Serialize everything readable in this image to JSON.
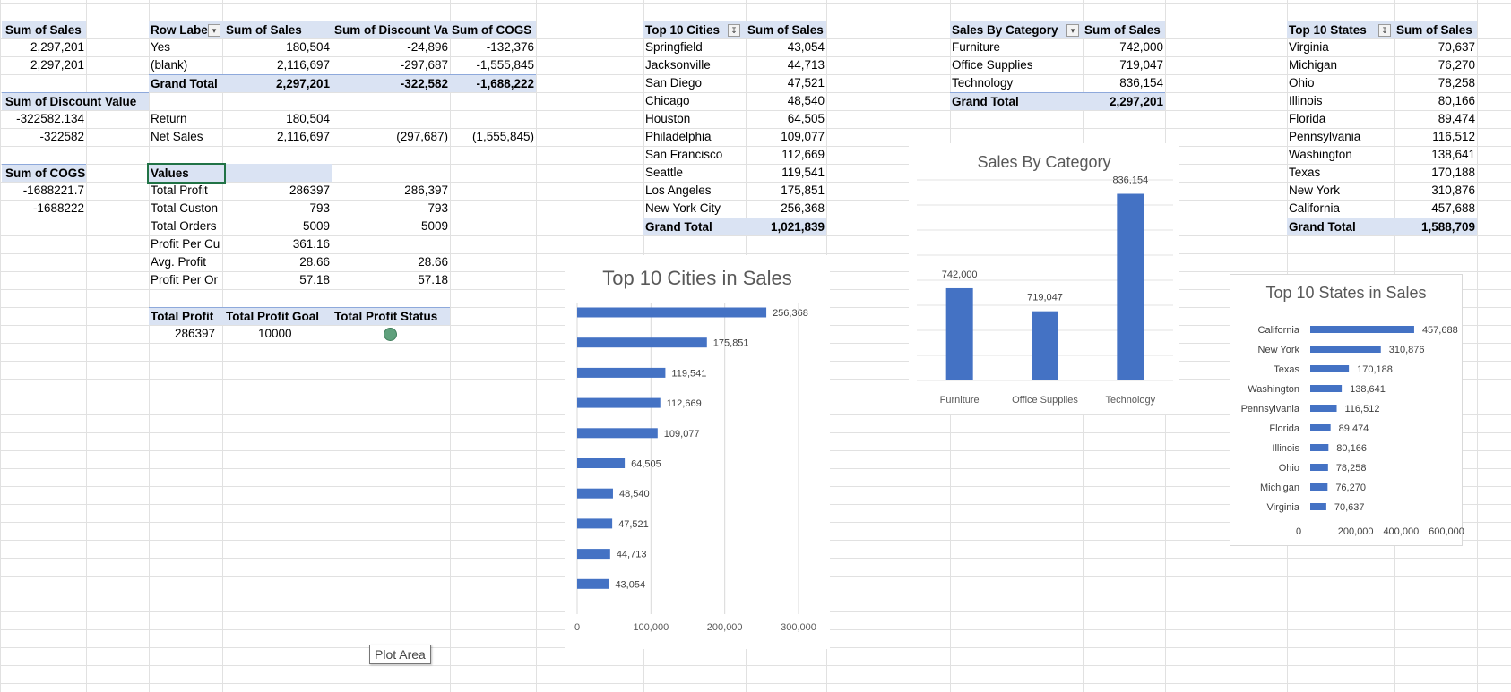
{
  "pivot_sales_total": {
    "header": "Sum of Sales",
    "values": [
      "2,297,201",
      "2,297,201"
    ]
  },
  "pivot_discount_total": {
    "header": "Sum of Discount Value",
    "values": [
      "-322582.134",
      "-322582"
    ]
  },
  "pivot_cogs_total": {
    "header": "Sum of COGS",
    "values": [
      "-1688221.7",
      "-1688222"
    ]
  },
  "pivot_main": {
    "headers": [
      "Row Labe",
      "Sum of Sales",
      "Sum of Discount Va",
      "Sum of COGS"
    ],
    "rows": [
      [
        "Yes",
        "180,504",
        "-24,896",
        "-132,376"
      ],
      [
        "(blank)",
        "2,116,697",
        "-297,687",
        "-1,555,845"
      ],
      [
        "Grand Total",
        "2,297,201",
        "-322,582",
        "-1,688,222"
      ]
    ]
  },
  "net_table": {
    "rows": [
      [
        "Return",
        "180,504",
        "",
        ""
      ],
      [
        "Net Sales",
        "2,116,697",
        "(297,687)",
        "(1,555,845)"
      ]
    ]
  },
  "values_table": {
    "header": "Values",
    "rows": [
      [
        "Total Profit",
        "286397",
        "286,397"
      ],
      [
        "Total Custon",
        "793",
        "793"
      ],
      [
        "Total Orders",
        "5009",
        "5009"
      ],
      [
        "Profit Per Cu",
        "361.16",
        ""
      ],
      [
        "Avg. Profit",
        "28.66",
        "28.66"
      ],
      [
        "Profit Per Or",
        "57.18",
        "57.18"
      ]
    ]
  },
  "goal_table": {
    "headers": [
      "Total Profit",
      "Total Profit Goal",
      "Total Profit Status"
    ],
    "values": [
      "286397",
      "10000"
    ]
  },
  "cities_pivot": {
    "headers": [
      "Top 10 Cities",
      "Sum of Sales"
    ],
    "rows": [
      [
        "Springfield",
        "43,054"
      ],
      [
        "Jacksonville",
        "44,713"
      ],
      [
        "San Diego",
        "47,521"
      ],
      [
        "Chicago",
        "48,540"
      ],
      [
        "Houston",
        "64,505"
      ],
      [
        "Philadelphia",
        "109,077"
      ],
      [
        "San Francisco",
        "112,669"
      ],
      [
        "Seattle",
        "119,541"
      ],
      [
        "Los Angeles",
        "175,851"
      ],
      [
        "New York City",
        "256,368"
      ]
    ],
    "total": [
      "Grand Total",
      "1,021,839"
    ]
  },
  "category_pivot": {
    "headers": [
      "Sales By Category",
      "Sum of Sales"
    ],
    "rows": [
      [
        "Furniture",
        "742,000"
      ],
      [
        "Office Supplies",
        "719,047"
      ],
      [
        "Technology",
        "836,154"
      ]
    ],
    "total": [
      "Grand Total",
      "2,297,201"
    ]
  },
  "states_pivot": {
    "headers": [
      "Top 10 States",
      "Sum of Sales"
    ],
    "rows": [
      [
        "Virginia",
        "70,637"
      ],
      [
        "Michigan",
        "76,270"
      ],
      [
        "Ohio",
        "78,258"
      ],
      [
        "Illinois",
        "80,166"
      ],
      [
        "Florida",
        "89,474"
      ],
      [
        "Pennsylvania",
        "116,512"
      ],
      [
        "Washington",
        "138,641"
      ],
      [
        "Texas",
        "170,188"
      ],
      [
        "New York",
        "310,876"
      ],
      [
        "California",
        "457,688"
      ]
    ],
    "total": [
      "Grand Total",
      "1,588,709"
    ]
  },
  "tooltip": "Plot Area",
  "colors": {
    "bar": "#4472c4",
    "header_fill": "#dae3f3",
    "status_dot": "#5fa07c"
  },
  "icons": {
    "filter": "filter-dropdown-icon",
    "filtered": "filter-active-icon"
  },
  "chart_data": [
    {
      "type": "bar",
      "orientation": "horizontal",
      "title": "Top 10 Cities in Sales",
      "categories": [
        "New York City",
        "Los Angeles",
        "Seattle",
        "San Francisco",
        "Philadelphia",
        "Houston",
        "Chicago",
        "San Diego",
        "Jacksonville",
        "Springfield"
      ],
      "values": [
        256368,
        175851,
        119541,
        112669,
        109077,
        64505,
        48540,
        47521,
        44713,
        43054
      ],
      "data_labels": [
        "256,368",
        "175,851",
        "119,541",
        "112,669",
        "109,077",
        "64,505",
        "48,540",
        "47,521",
        "44,713",
        "43,054"
      ],
      "xlim": [
        0,
        300000
      ],
      "xticks": [
        "0",
        "100,000",
        "200,000",
        "300,000"
      ],
      "category_labels_shown": false,
      "grid": true
    },
    {
      "type": "bar",
      "title": "Sales By Category",
      "categories": [
        "Furniture",
        "Office Supplies",
        "Technology"
      ],
      "values": [
        742000,
        719047,
        836154
      ],
      "data_labels": [
        "742,000",
        "719,047",
        "836,154"
      ],
      "ylim": [
        650000,
        850000
      ],
      "grid": true
    },
    {
      "type": "bar",
      "orientation": "horizontal",
      "title": "Top 10 States in Sales",
      "categories": [
        "California",
        "New York",
        "Texas",
        "Washington",
        "Pennsylvania",
        "Florida",
        "Illinois",
        "Ohio",
        "Michigan",
        "Virginia"
      ],
      "values": [
        457688,
        310876,
        170188,
        138641,
        116512,
        89474,
        80166,
        78258,
        76270,
        70637
      ],
      "data_labels": [
        "457,688",
        "310,876",
        "170,188",
        "138,641",
        "116,512",
        "89,474",
        "80,166",
        "78,258",
        "76,270",
        "70,637"
      ],
      "xlim": [
        0,
        600000
      ],
      "xticks": [
        "0",
        "200,000",
        "400,000",
        "600,000"
      ],
      "grid": false
    }
  ]
}
